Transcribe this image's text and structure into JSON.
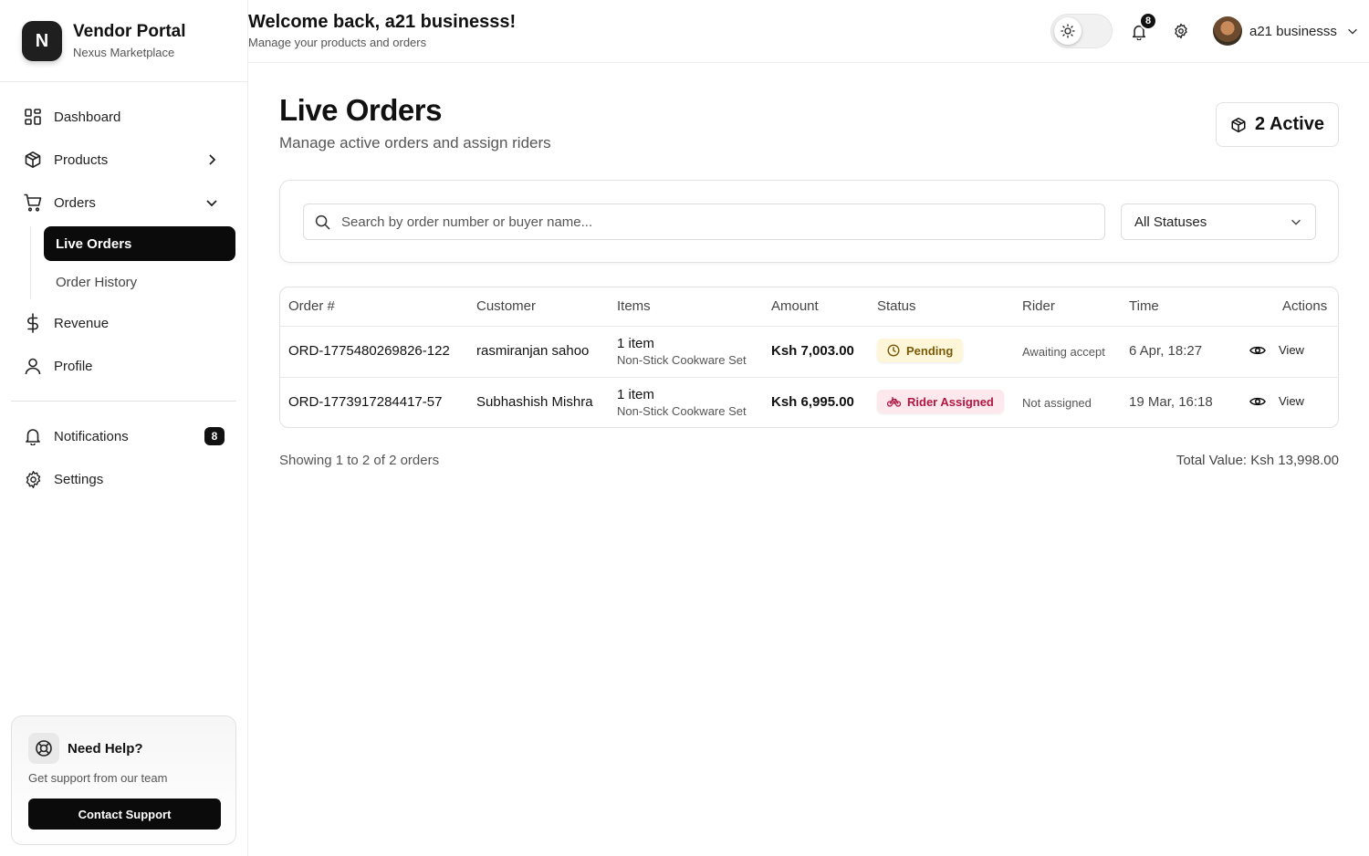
{
  "brand": {
    "logo_letter": "N",
    "title": "Vendor Portal",
    "subtitle": "Nexus Marketplace"
  },
  "sidebar": {
    "items": [
      {
        "label": "Dashboard",
        "icon": "grid-icon"
      },
      {
        "label": "Products",
        "icon": "box-icon"
      },
      {
        "label": "Orders",
        "icon": "cart-icon"
      },
      {
        "label": "Revenue",
        "icon": "dollar-icon"
      },
      {
        "label": "Profile",
        "icon": "user-icon"
      },
      {
        "label": "Notifications",
        "icon": "bell-icon",
        "badge": "8"
      },
      {
        "label": "Settings",
        "icon": "gear-icon"
      }
    ],
    "orders_sub": [
      {
        "label": "Live Orders"
      },
      {
        "label": "Order History"
      }
    ]
  },
  "help": {
    "title": "Need Help?",
    "subtitle": "Get support from our team",
    "button": "Contact Support"
  },
  "header": {
    "welcome": "Welcome back, a21 businesss!",
    "subtitle": "Manage your products and orders",
    "notif_count": "8",
    "user_name": "a21 businesss"
  },
  "page": {
    "title": "Live Orders",
    "subtitle": "Manage active orders and assign riders",
    "active_count": "2 Active"
  },
  "filters": {
    "search_placeholder": "Search by order number or buyer name...",
    "status_selected": "All Statuses"
  },
  "table": {
    "headers": [
      "Order #",
      "Customer",
      "Items",
      "Amount",
      "Status",
      "Rider",
      "Time",
      "Actions"
    ],
    "rows": [
      {
        "order": "ORD-1775480269826-122",
        "customer": "rasmiranjan sahoo",
        "items_count": "1 item",
        "items_name": "Non-Stick Cookware Set",
        "amount": "Ksh 7,003.00",
        "status": "Pending",
        "rider": "Awaiting accept",
        "time": "6 Apr, 18:27",
        "action": "View"
      },
      {
        "order": "ORD-1773917284417-57",
        "customer": "Subhashish Mishra",
        "items_count": "1 item",
        "items_name": "Non-Stick Cookware Set",
        "amount": "Ksh 6,995.00",
        "status": "Rider Assigned",
        "rider": "Not assigned",
        "time": "19 Mar, 16:18",
        "action": "View"
      }
    ]
  },
  "footer": {
    "showing": "Showing 1 to 2 of 2 orders",
    "total": "Total Value: Ksh 13,998.00"
  },
  "colors": {
    "primary": "#0b0b0b",
    "pending_bg": "#fdf6d8",
    "pending_fg": "#7a5a07",
    "rider_bg": "#fde8ee",
    "rider_fg": "#b01743"
  }
}
